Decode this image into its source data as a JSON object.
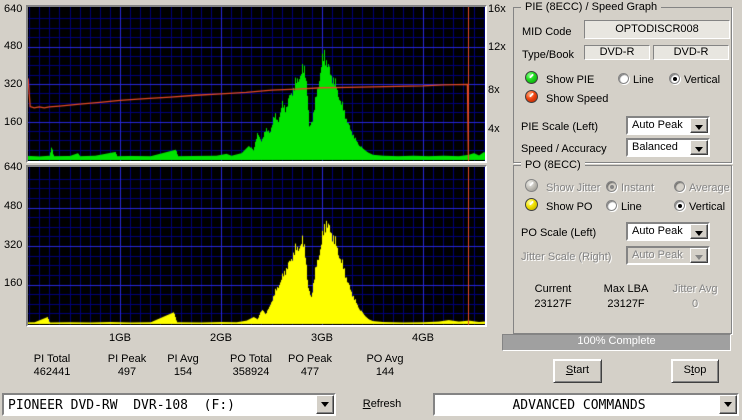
{
  "graph_axes": {
    "top_left": [
      "640",
      "480",
      "320",
      "160"
    ],
    "top_right": [
      "16x",
      "12x",
      "8x",
      "4x"
    ],
    "bottom_left": [
      "640",
      "480",
      "320",
      "160"
    ],
    "x_ticks": [
      "1GB",
      "2GB",
      "3GB",
      "4GB"
    ]
  },
  "chart_data": {
    "type": "area",
    "x_unit": "GB",
    "x_range_gb": [
      0,
      4.63
    ],
    "grid": {
      "bg": "#000000",
      "major_color": "#2828d8",
      "minor_color": "#000078",
      "x_major_step_gb": 1,
      "x_minor_step_gb": 0.1,
      "y_major_step": 160,
      "y_minor_step": 40
    },
    "end_marker_gb": 4.45,
    "end_marker_color": "#e44a28",
    "top_graph": {
      "name": "PIE (8ECC) / Speed",
      "ylim": [
        0,
        640
      ],
      "right_axis_max_speed": 16,
      "series": [
        {
          "name": "PIE",
          "style": "vertical",
          "color": "#00e400",
          "points": [
            [
              0.0,
              10
            ],
            [
              0.1,
              13
            ],
            [
              0.2,
              11
            ],
            [
              0.3,
              14
            ],
            [
              0.32,
              55
            ],
            [
              0.34,
              12
            ],
            [
              0.5,
              13
            ],
            [
              0.58,
              25
            ],
            [
              0.6,
              12
            ],
            [
              0.75,
              14
            ],
            [
              0.95,
              30
            ],
            [
              0.97,
              12
            ],
            [
              1.1,
              13
            ],
            [
              1.3,
              12
            ],
            [
              1.55,
              40
            ],
            [
              1.57,
              12
            ],
            [
              1.75,
              13
            ],
            [
              1.95,
              14
            ],
            [
              2.05,
              22
            ],
            [
              2.1,
              14
            ],
            [
              2.2,
              25
            ],
            [
              2.28,
              60
            ],
            [
              2.32,
              35
            ],
            [
              2.36,
              130
            ],
            [
              2.4,
              80
            ],
            [
              2.44,
              150
            ],
            [
              2.48,
              120
            ],
            [
              2.52,
              210
            ],
            [
              2.56,
              180
            ],
            [
              2.6,
              260
            ],
            [
              2.64,
              240
            ],
            [
              2.68,
              310
            ],
            [
              2.72,
              340
            ],
            [
              2.76,
              390
            ],
            [
              2.8,
              420
            ],
            [
              2.83,
              430
            ],
            [
              2.85,
              330
            ],
            [
              2.87,
              150
            ],
            [
              2.9,
              190
            ],
            [
              2.93,
              270
            ],
            [
              2.96,
              360
            ],
            [
              2.99,
              450
            ],
            [
              3.02,
              497
            ],
            [
              3.05,
              460
            ],
            [
              3.08,
              410
            ],
            [
              3.12,
              370
            ],
            [
              3.16,
              310
            ],
            [
              3.2,
              250
            ],
            [
              3.24,
              190
            ],
            [
              3.28,
              140
            ],
            [
              3.32,
              100
            ],
            [
              3.36,
              70
            ],
            [
              3.4,
              45
            ],
            [
              3.45,
              28
            ],
            [
              3.5,
              18
            ],
            [
              3.6,
              14
            ],
            [
              3.75,
              12
            ],
            [
              3.9,
              14
            ],
            [
              4.05,
              12
            ],
            [
              4.2,
              14
            ],
            [
              4.35,
              12
            ],
            [
              4.45,
              18
            ],
            [
              4.5,
              25
            ],
            [
              4.55,
              15
            ],
            [
              4.6,
              30
            ],
            [
              4.63,
              20
            ]
          ]
        },
        {
          "name": "Speed",
          "style": "line",
          "color": "#e44a28",
          "axis": "right",
          "unit_scale": 40,
          "points": [
            [
              0.09,
              8.6
            ],
            [
              0.11,
              5.6
            ],
            [
              0.15,
              5.45
            ],
            [
              0.2,
              5.55
            ],
            [
              0.25,
              5.45
            ],
            [
              0.3,
              5.55
            ],
            [
              0.4,
              5.65
            ],
            [
              0.6,
              5.85
            ],
            [
              0.8,
              6.05
            ],
            [
              1.0,
              6.25
            ],
            [
              1.25,
              6.45
            ],
            [
              1.5,
              6.6
            ],
            [
              1.75,
              6.8
            ],
            [
              2.0,
              6.95
            ],
            [
              2.25,
              7.1
            ],
            [
              2.5,
              7.35
            ],
            [
              2.75,
              7.45
            ],
            [
              3.0,
              7.6
            ],
            [
              3.25,
              7.65
            ],
            [
              3.5,
              7.7
            ],
            [
              3.75,
              7.75
            ],
            [
              4.0,
              7.8
            ],
            [
              4.2,
              7.9
            ],
            [
              4.44,
              7.95
            ],
            [
              4.45,
              0
            ]
          ]
        }
      ]
    },
    "bottom_graph": {
      "name": "PO (8ECC)",
      "ylim": [
        0,
        640
      ],
      "series": [
        {
          "name": "PO",
          "style": "vertical",
          "color": "#ffff00",
          "points": [
            [
              0.0,
              2
            ],
            [
              0.15,
              3
            ],
            [
              0.28,
              25
            ],
            [
              0.3,
              2
            ],
            [
              0.5,
              3
            ],
            [
              0.7,
              2
            ],
            [
              0.9,
              4
            ],
            [
              1.1,
              2
            ],
            [
              1.3,
              3
            ],
            [
              1.53,
              45
            ],
            [
              1.56,
              3
            ],
            [
              1.8,
              2
            ],
            [
              2.0,
              4
            ],
            [
              2.15,
              3
            ],
            [
              2.25,
              10
            ],
            [
              2.32,
              25
            ],
            [
              2.36,
              15
            ],
            [
              2.4,
              60
            ],
            [
              2.44,
              35
            ],
            [
              2.48,
              80
            ],
            [
              2.52,
              130
            ],
            [
              2.56,
              170
            ],
            [
              2.6,
              210
            ],
            [
              2.64,
              250
            ],
            [
              2.68,
              290
            ],
            [
              2.72,
              330
            ],
            [
              2.76,
              355
            ],
            [
              2.8,
              380
            ],
            [
              2.83,
              340
            ],
            [
              2.86,
              160
            ],
            [
              2.89,
              120
            ],
            [
              2.92,
              210
            ],
            [
              2.95,
              290
            ],
            [
              2.98,
              350
            ],
            [
              3.01,
              420
            ],
            [
              3.04,
              477
            ],
            [
              3.07,
              440
            ],
            [
              3.1,
              410
            ],
            [
              3.14,
              360
            ],
            [
              3.18,
              300
            ],
            [
              3.22,
              240
            ],
            [
              3.26,
              180
            ],
            [
              3.3,
              130
            ],
            [
              3.34,
              90
            ],
            [
              3.38,
              55
            ],
            [
              3.42,
              30
            ],
            [
              3.46,
              15
            ],
            [
              3.5,
              8
            ],
            [
              3.6,
              4
            ],
            [
              3.8,
              2
            ],
            [
              4.0,
              3
            ],
            [
              4.15,
              6
            ],
            [
              4.25,
              12
            ],
            [
              4.35,
              6
            ],
            [
              4.45,
              10
            ],
            [
              4.55,
              4
            ],
            [
              4.6,
              6
            ]
          ]
        }
      ]
    }
  },
  "pie_group": {
    "title": "PIE (8ECC) / Speed Graph",
    "mid_code_label": "MID Code",
    "mid_code_value": "OPTODISCR008",
    "type_book_label": "Type/Book",
    "type_book_values": [
      "DVD-R",
      "DVD-R"
    ],
    "show_pie_label": "Show PIE",
    "show_speed_label": "Show Speed",
    "line_label": "Line",
    "vertical_label": "Vertical",
    "pie_scale_label": "PIE Scale (Left)",
    "pie_scale_value": "Auto Peak",
    "speed_accuracy_label": "Speed / Accuracy",
    "speed_accuracy_value": "Balanced"
  },
  "po_group": {
    "title": "PO (8ECC)",
    "show_jitter_label": "Show Jitter",
    "instant_label": "Instant",
    "average_label": "Average",
    "show_po_label": "Show PO",
    "line_label": "Line",
    "vertical_label": "Vertical",
    "po_scale_label": "PO Scale (Left)",
    "po_scale_value": "Auto Peak",
    "jitter_scale_label": "Jitter Scale (Right)",
    "jitter_scale_value": "Auto Peak",
    "current_label": "Current",
    "current_value": "23127F",
    "max_lba_label": "Max LBA",
    "max_lba_value": "23127F",
    "jitter_avg_label": "Jitter Avg",
    "jitter_avg_value": "0"
  },
  "progress": {
    "percent": 100,
    "label": "100% Complete"
  },
  "buttons": {
    "start_u": "S",
    "start_rest": "tart",
    "stop_pre": "S",
    "stop_u": "t",
    "stop_rest": "op"
  },
  "stats": {
    "items": [
      {
        "label": "PI Total",
        "value": "462441"
      },
      {
        "label": "PI Peak",
        "value": "497"
      },
      {
        "label": "PI Avg",
        "value": "154"
      },
      {
        "label": "PO Total",
        "value": "358924"
      },
      {
        "label": "PO Peak",
        "value": "477"
      },
      {
        "label": "PO Avg",
        "value": "144"
      }
    ]
  },
  "bottom_bar": {
    "drive_value": "PIONEER DVD-RW  DVR-108  (F:)",
    "refresh_u": "R",
    "refresh_rest": "efresh",
    "advanced_value": "ADVANCED COMMANDS"
  },
  "colors": {
    "dialog_bg": "#d4d0c8",
    "plot_bg": "#000000",
    "grid_major": "#2828d8",
    "grid_minor": "#000078",
    "pie_green": "#00e400",
    "po_yellow": "#ffff00",
    "speed_red": "#e44a28",
    "progress_fill": "#a0a0a0",
    "led_green": "#22dd22",
    "led_red": "#ee4411",
    "led_yellow": "#f0e000",
    "led_disabled": "#c0bdb6"
  }
}
